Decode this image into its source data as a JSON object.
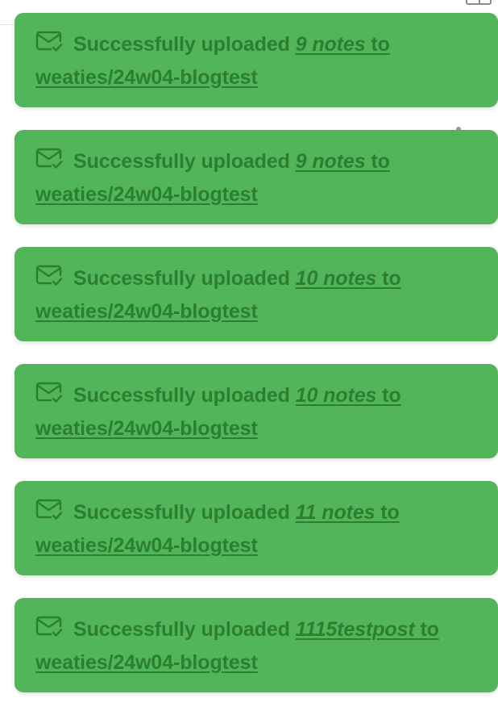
{
  "notices": [
    {
      "prefix": "Successfully uploaded ",
      "count_label": "9 notes",
      "middle": " to ",
      "repo": "weaties/24w04-blogtest"
    },
    {
      "prefix": "Successfully uploaded ",
      "count_label": "9 notes",
      "middle": " to ",
      "repo": "weaties/24w04-blogtest"
    },
    {
      "prefix": "Successfully uploaded ",
      "count_label": "10 notes",
      "middle": " to ",
      "repo": "weaties/24w04-blogtest"
    },
    {
      "prefix": "Successfully uploaded ",
      "count_label": "10 notes",
      "middle": " to ",
      "repo": "weaties/24w04-blogtest"
    },
    {
      "prefix": "Successfully uploaded ",
      "count_label": "11 notes",
      "middle": " to ",
      "repo": "weaties/24w04-blogtest"
    },
    {
      "prefix": "Successfully uploaded ",
      "count_label": "1115testpost",
      "middle": " to ",
      "repo": "weaties/24w04-blogtest"
    }
  ],
  "icon": "mail-check-icon",
  "colors": {
    "toast_background": "#53b55a",
    "toast_text": "#2c7e31"
  }
}
